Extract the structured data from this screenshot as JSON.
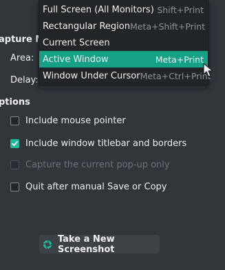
{
  "capture_mode": {
    "title": "apture Mo",
    "area_label": "Area:",
    "delay_label": "Delay:"
  },
  "options": {
    "title": "ptions",
    "items": [
      {
        "label": "Include mouse pointer",
        "checked": false,
        "enabled": true
      },
      {
        "label": "Include window titlebar and borders",
        "checked": true,
        "enabled": true
      },
      {
        "label": "Capture the current pop-up only",
        "checked": false,
        "enabled": false
      },
      {
        "label": "Quit after manual Save or Copy",
        "checked": false,
        "enabled": true
      }
    ]
  },
  "take_button": {
    "label": "Take a New Screenshot",
    "icon": "screenshot-shutter-icon"
  },
  "area_menu": {
    "items": [
      {
        "label": "Full Screen (All Monitors)",
        "shortcut": "Shift+Print",
        "active": false
      },
      {
        "label": "Rectangular Region",
        "shortcut": "Meta+Shift+Print",
        "active": false
      },
      {
        "label": "Current Screen",
        "shortcut": "",
        "active": false
      },
      {
        "label": "Active Window",
        "shortcut": "Meta+Print",
        "active": true
      },
      {
        "label": "Window Under Cursor",
        "shortcut": "Meta+Ctrl+Print",
        "active": false
      }
    ]
  },
  "colors": {
    "background": "#31363b",
    "accent": "#1abc9c",
    "highlight": "#16a085",
    "menu_background": "#232629"
  }
}
